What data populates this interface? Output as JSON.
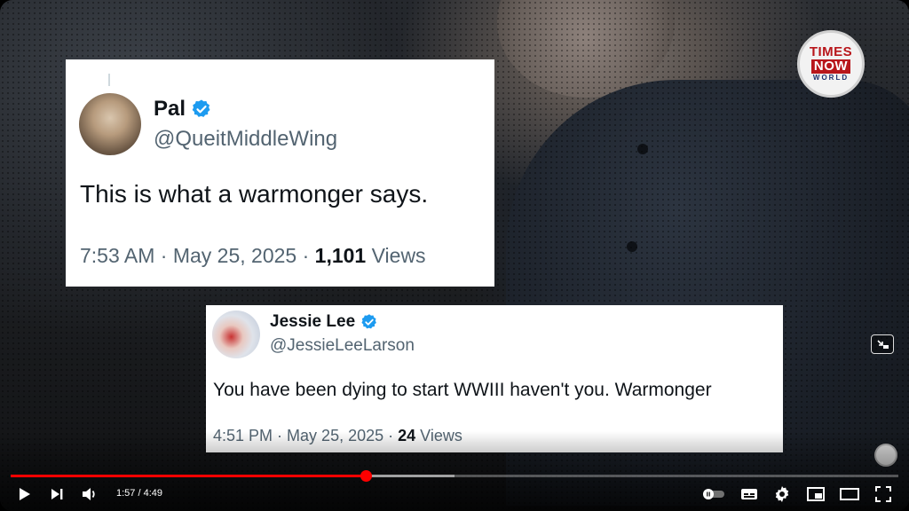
{
  "video": {
    "watermark": {
      "line1": "TIMES",
      "line2": "NOW",
      "line3": "WORLD"
    },
    "progress_fraction": 0.4
  },
  "tweets": [
    {
      "name": "Pal",
      "handle": "@QueitMiddleWing",
      "body": "This is what a warmonger says.",
      "time": "7:53 AM",
      "date": "May 25, 2025",
      "views_count": "1,101",
      "views_label": "Views"
    },
    {
      "name": "Jessie Lee",
      "handle": "@JessieLeeLarson",
      "body": "You have been dying to start WWIII haven't you. Warmonger",
      "time": "4:51 PM",
      "date": "May 25, 2025",
      "views_count": "24",
      "views_label": "Views"
    }
  ],
  "controls": {
    "current_time": "1:57",
    "separator": "/",
    "duration": "4:49"
  },
  "colors": {
    "verified_blue": "#1d9bf0",
    "progress_red": "#ff0000"
  }
}
